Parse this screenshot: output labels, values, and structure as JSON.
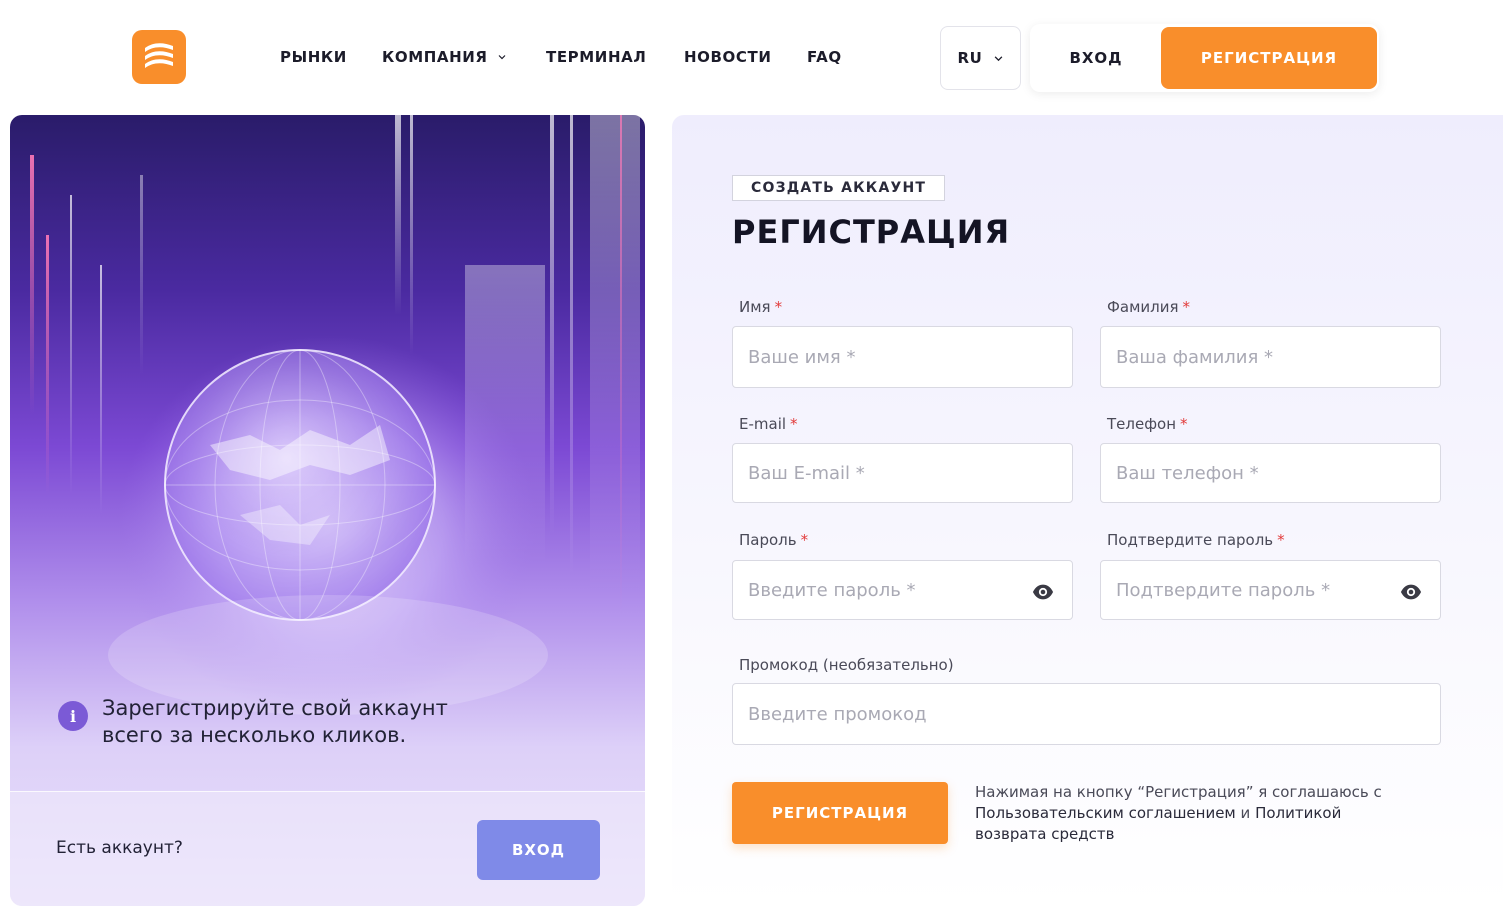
{
  "header": {
    "logo_icon": "brand-wave-logo",
    "nav": [
      {
        "label": "РЫНКИ"
      },
      {
        "label": "КОМПАНИЯ"
      },
      {
        "label": "ТЕРМИНАЛ"
      },
      {
        "label": "НОВОСТИ"
      },
      {
        "label": "FAQ"
      }
    ],
    "lang": "RU",
    "login_label": "ВХОД",
    "register_label": "РЕГИСТРАЦИЯ"
  },
  "left": {
    "info_icon": "info-icon",
    "info_text": "Зарегистрируйте свой аккаунт всего за несколько кликов.",
    "have_account": "Есть аккаунт?",
    "login_label": "ВХОД"
  },
  "form": {
    "badge": "СОЗДАТЬ АККАУНТ",
    "title": "РЕГИСТРАЦИЯ",
    "required_mark": "*",
    "first_name": {
      "label": "Имя",
      "placeholder": "Ваше имя *"
    },
    "last_name": {
      "label": "Фамилия",
      "placeholder": "Ваша фамилия *"
    },
    "email": {
      "label": "E-mail",
      "placeholder": "Ваш E-mail *"
    },
    "phone": {
      "label": "Телефон",
      "placeholder": "Ваш телефон *"
    },
    "password": {
      "label": "Пароль",
      "placeholder": "Введите пароль *"
    },
    "confirm_password": {
      "label": "Подтвердите пароль",
      "placeholder": "Подтвердите пароль *"
    },
    "promo": {
      "label": "Промокод (необязательно)",
      "placeholder": "Введите промокод"
    },
    "submit_label": "РЕГИСТРАЦИЯ",
    "agree_prefix": "Нажимая на кнопку “Регистрация” я соглашаюсь с",
    "agree_link1": "Пользовательским соглашением",
    "agree_and": "и",
    "agree_link2": "Политикой возврата средств"
  },
  "colors": {
    "accent": "#f98e2b",
    "secondary_button": "#7f8ae8",
    "required": "#e23b3b"
  }
}
